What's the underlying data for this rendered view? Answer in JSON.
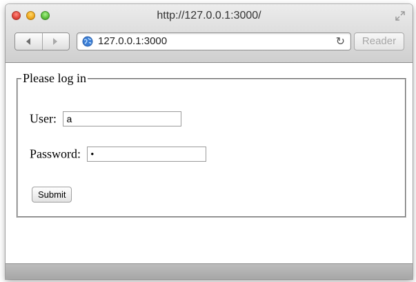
{
  "window": {
    "title": "http://127.0.0.1:3000/"
  },
  "toolbar": {
    "url": "127.0.0.1:3000",
    "reload_icon": "reload-icon",
    "reader_label": "Reader"
  },
  "form": {
    "legend": "Please log in",
    "user_label": "User:",
    "user_value": "a",
    "password_label": "Password:",
    "password_value": "•",
    "submit_label": "Submit"
  },
  "colors": {
    "close": "#e0443a",
    "minimize": "#f0a81e",
    "zoom": "#5bbf3a",
    "globe": "#3d7fd6"
  }
}
